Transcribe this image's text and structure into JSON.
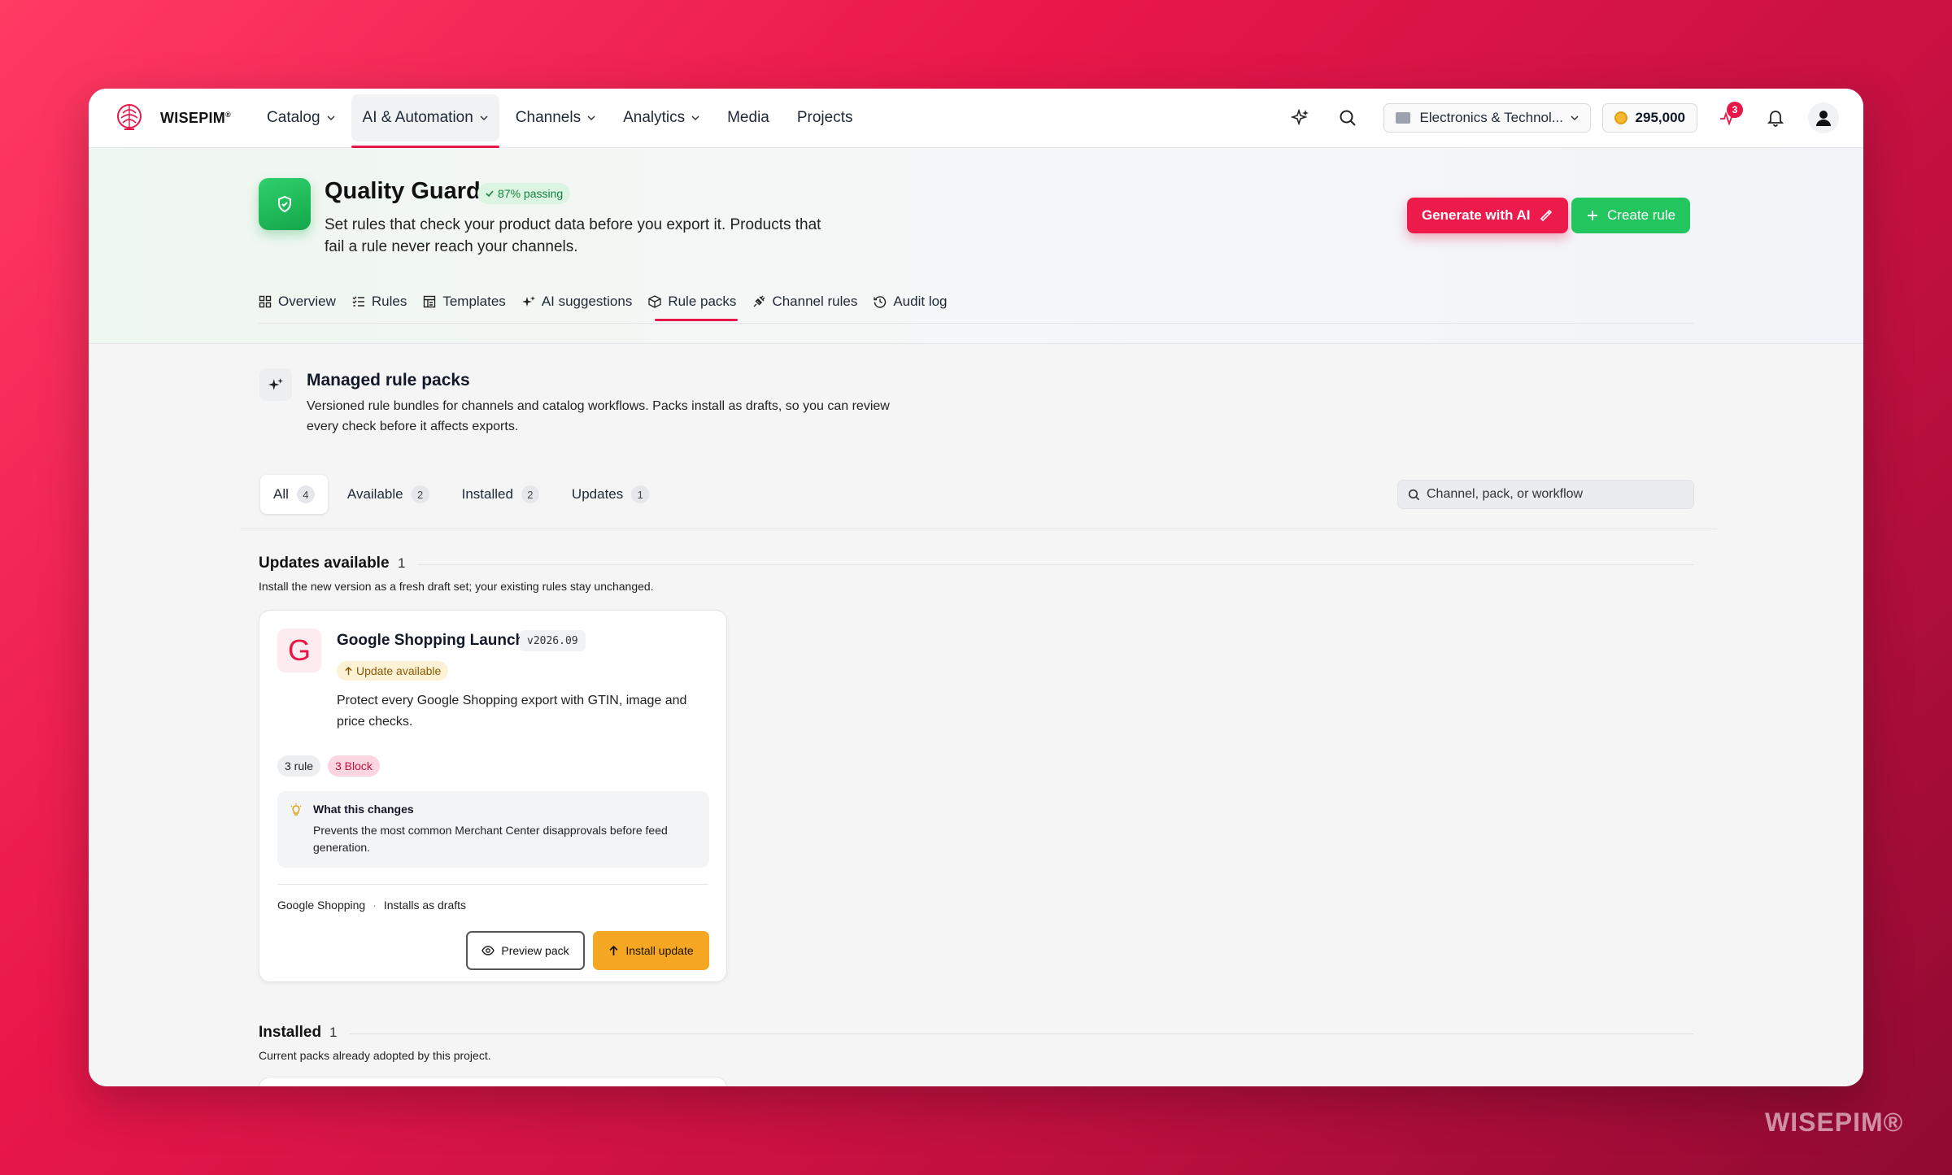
{
  "app": {
    "brand": "WISEPIM",
    "brand_mark": "®"
  },
  "nav": {
    "items": [
      {
        "label": "Catalog",
        "dropdown": true
      },
      {
        "label": "AI & Automation",
        "dropdown": true,
        "active": true
      },
      {
        "label": "Channels",
        "dropdown": true
      },
      {
        "label": "Analytics",
        "dropdown": true
      },
      {
        "label": "Media"
      },
      {
        "label": "Projects"
      }
    ],
    "workspace": "Electronics & Technol...",
    "credits": "295,000",
    "activity_count": "3"
  },
  "header": {
    "title": "Quality Guard",
    "status_pill": "87% passing",
    "description": "Set rules that check your product data before you export it. Products that fail a rule never reach your channels.",
    "generate_button": "Generate with AI",
    "create_button": "Create rule",
    "tabs": [
      {
        "label": "Overview",
        "icon": "grid-icon"
      },
      {
        "label": "Rules",
        "icon": "list-check-icon"
      },
      {
        "label": "Templates",
        "icon": "template-icon"
      },
      {
        "label": "AI suggestions",
        "icon": "sparkles-icon"
      },
      {
        "label": "Rule packs",
        "icon": "package-icon",
        "active": true
      },
      {
        "label": "Channel rules",
        "icon": "plug-icon"
      },
      {
        "label": "Audit log",
        "icon": "history-icon"
      }
    ]
  },
  "section": {
    "title": "Managed rule packs",
    "description": "Versioned rule bundles for channels and catalog workflows. Packs install as drafts, so you can review every check before it affects exports."
  },
  "filters": [
    {
      "label": "All",
      "count": "4",
      "active": true
    },
    {
      "label": "Available",
      "count": "2"
    },
    {
      "label": "Installed",
      "count": "2"
    },
    {
      "label": "Updates",
      "count": "1"
    }
  ],
  "search": {
    "placeholder": "Channel, pack, or workflow"
  },
  "groups": {
    "updates": {
      "title": "Updates available",
      "count": "1",
      "description": "Install the new version as a fresh draft set; your existing rules stay unchanged."
    },
    "installed": {
      "title": "Installed",
      "count": "1",
      "description": "Current packs already adopted by this project."
    }
  },
  "card": {
    "logo": "G",
    "title": "Google Shopping Launch",
    "version": "v2026.09",
    "status": "Update available",
    "description": "Protect every Google Shopping export with GTIN, image and price checks.",
    "tag_rules": "3 rule",
    "tag_block": "3 Block",
    "changes_title": "What this changes",
    "changes_text": "Prevents the most common Merchant Center disapprovals before feed generation.",
    "channel": "Google Shopping",
    "install_mode": "Installs as drafts",
    "preview_button": "Preview pack",
    "install_button": "Install update"
  },
  "watermark": "WISEPIM®",
  "colors": {
    "accent": "#e8174a",
    "success": "#22c55e",
    "warning": "#f5a623"
  }
}
